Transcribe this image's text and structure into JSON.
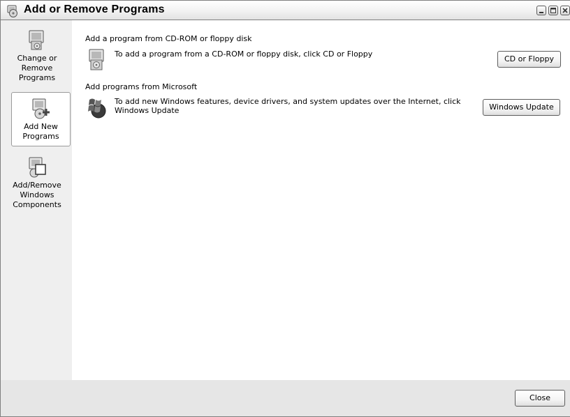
{
  "window": {
    "title": "Add or Remove Programs"
  },
  "titlebar_buttons": [
    {
      "name": "minimize-button",
      "icon": "minimize-icon"
    },
    {
      "name": "maximize-button",
      "icon": "maximize-icon"
    },
    {
      "name": "close-button",
      "icon": "close-icon"
    }
  ],
  "sidebar": {
    "items": [
      {
        "label": "Change or\nRemove\nPrograms",
        "icon": "change-remove-programs-icon",
        "selected": false
      },
      {
        "label": "Add New\nPrograms",
        "icon": "add-new-programs-icon",
        "selected": true
      },
      {
        "label": "Add/Remove\nWindows\nComponents",
        "icon": "windows-components-icon",
        "selected": false
      }
    ]
  },
  "main": {
    "sections": [
      {
        "header": "Add a program from CD-ROM or floppy disk",
        "icon": "cd-floppy-icon",
        "description": "To add a program from a CD-ROM or floppy disk, click CD or Floppy",
        "button_label": "CD or Floppy"
      },
      {
        "header": "Add programs from Microsoft",
        "icon": "windows-update-icon",
        "description": "To add new Windows features, device drivers, and system updates over the Internet, click\nWindows Update",
        "button_label": "Windows Update"
      }
    ]
  },
  "footer": {
    "close_label": "Close"
  }
}
